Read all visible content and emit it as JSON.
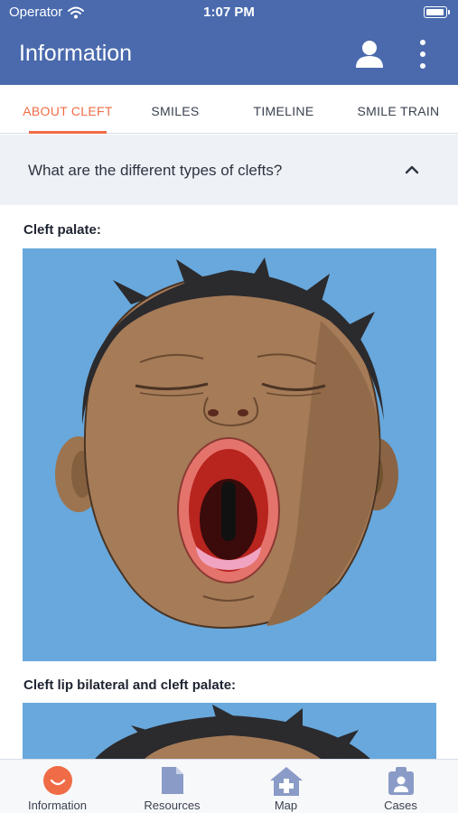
{
  "status_bar": {
    "carrier": "Operator",
    "time": "1:07 PM"
  },
  "app_bar": {
    "title": "Information"
  },
  "tabs": [
    {
      "label": "ABOUT CLEFT",
      "active": true
    },
    {
      "label": "SMILES",
      "active": false
    },
    {
      "label": "TIMELINE",
      "active": false
    },
    {
      "label": "SMILE TRAIN",
      "active": false
    }
  ],
  "accordion": {
    "question": "What are the different types of clefts?",
    "expanded": true
  },
  "sections": [
    {
      "title": "Cleft palate:"
    },
    {
      "title": "Cleft lip bilateral and cleft palate:"
    }
  ],
  "bottom_nav": [
    {
      "label": "Information",
      "icon": "smile-icon",
      "active": true
    },
    {
      "label": "Resources",
      "icon": "document-icon",
      "active": false
    },
    {
      "label": "Map",
      "icon": "home-plus-icon",
      "active": false
    },
    {
      "label": "Cases",
      "icon": "id-badge-icon",
      "active": false
    }
  ],
  "colors": {
    "primary": "#4a6aad",
    "accent": "#ef6c46",
    "illustration_bg": "#68a8dc",
    "skin": "#a57b58"
  }
}
